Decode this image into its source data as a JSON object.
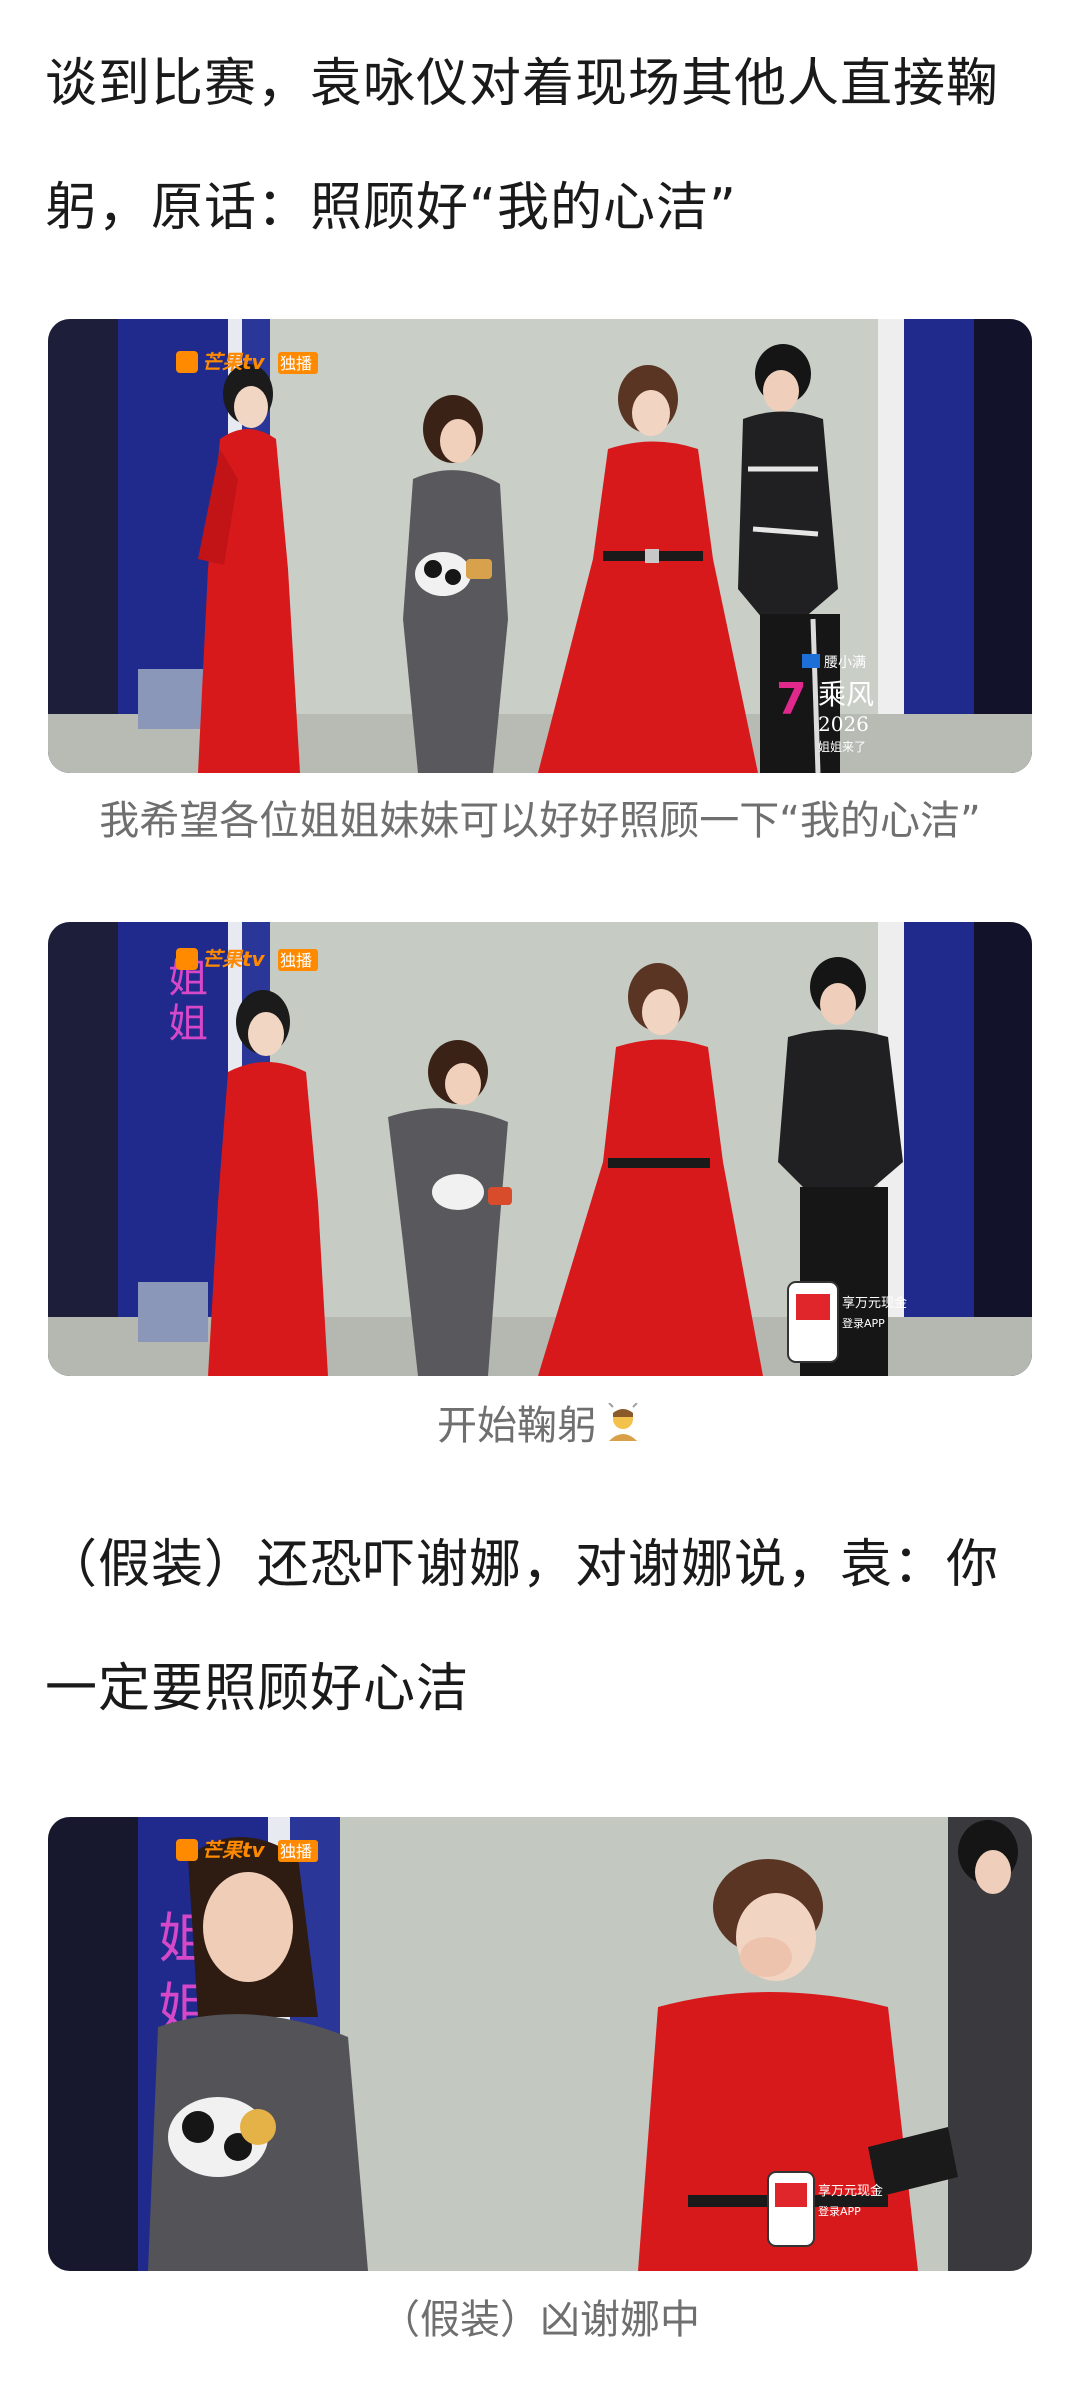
{
  "paragraphs": {
    "p1": "谈到比赛，袁咏仪对着现场其他人直接鞠躬，原话：照顾好“我的心洁”",
    "p2": "（假装）还恐吓谢娜，对谢娜说，袁：你一定要照顾好心洁"
  },
  "captions": {
    "c1": "我希望各位姐姐妹妹可以好好照顾一下“我的心洁”",
    "c2": "开始鞠躬",
    "c3": "（假装）凶谢娜中"
  },
  "photos": {
    "photo1": {
      "logo": "芒果tv",
      "badge": "独播",
      "sponsor": "腰小满",
      "show_logo": "乘风",
      "show_year": "2026",
      "show_sub": "姐姐来了"
    },
    "photo2": {
      "logo": "芒果tv",
      "badge": "独播",
      "phone_line1": "享万元现金",
      "phone_line2": "登录APP"
    },
    "photo3": {
      "logo": "芒果tv",
      "badge": "独播",
      "phone_line1": "享万元现金",
      "phone_line2": "登录APP"
    }
  },
  "icons": {
    "bow_emoji": "person-bowing-icon"
  },
  "colors": {
    "text": "#1a1a1a",
    "caption": "#6f6f6f",
    "red_dress": "#d8191c",
    "stage_blue": "#1f2a8c",
    "wall": "#c8cdc6",
    "suit_grey": "#5a5a5e"
  }
}
